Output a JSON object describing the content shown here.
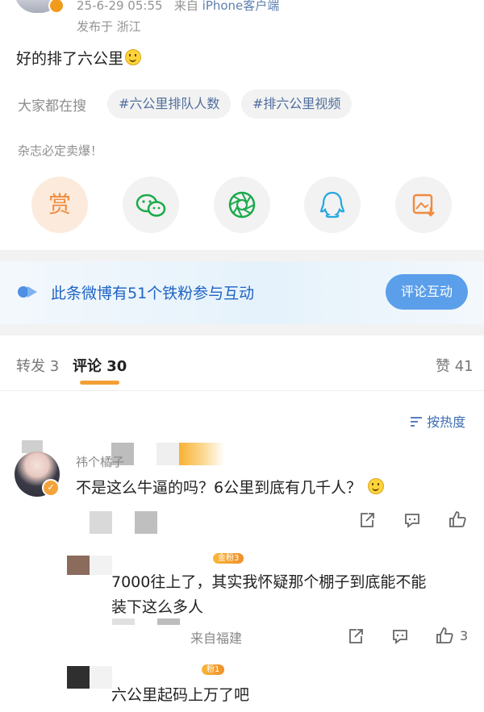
{
  "post": {
    "meta_time": "25-6-29 05:55",
    "meta_from": "来自",
    "meta_source": "iPhone客户端",
    "location": "发布于 浙江",
    "content": "好的排了六公里",
    "emoji": "smile-emoji"
  },
  "search": {
    "label": "大家都在搜",
    "chips": [
      "#六公里排队人数",
      "#排六公里视频"
    ]
  },
  "reward": {
    "caption": "杂志必定卖爆！",
    "reward_glyph": "赏"
  },
  "share_buttons": [
    "reward-icon",
    "wechat-icon",
    "moments-icon",
    "qq-icon",
    "save-image-icon"
  ],
  "fans_banner": {
    "text": "此条微博有51个铁粉参与互动",
    "button": "评论互动"
  },
  "tabs": {
    "repost": "转发 3",
    "comments": "评论 30",
    "likes": "赞 41"
  },
  "sort": {
    "label": "按热度"
  },
  "comments": [
    {
      "username": "祎个橘子",
      "text": "不是这么牛逼的吗？6公里到底有几千人？",
      "emoji": "smirk-emoji"
    }
  ],
  "replies": [
    {
      "badge": "金粉3",
      "text_line1": "7000往上了，其实我怀疑那个棚子到底能不能",
      "text_line2": "装下这么多人",
      "location": "来自福建",
      "like_count": "3"
    },
    {
      "badge": "粉1",
      "text_line1": "六公里起码上万了吧"
    }
  ],
  "colors": {
    "accent_orange": "#f29f35",
    "link_blue": "#3e6db0",
    "banner_blue": "#1e63c5",
    "button_blue": "#5b9fea"
  }
}
